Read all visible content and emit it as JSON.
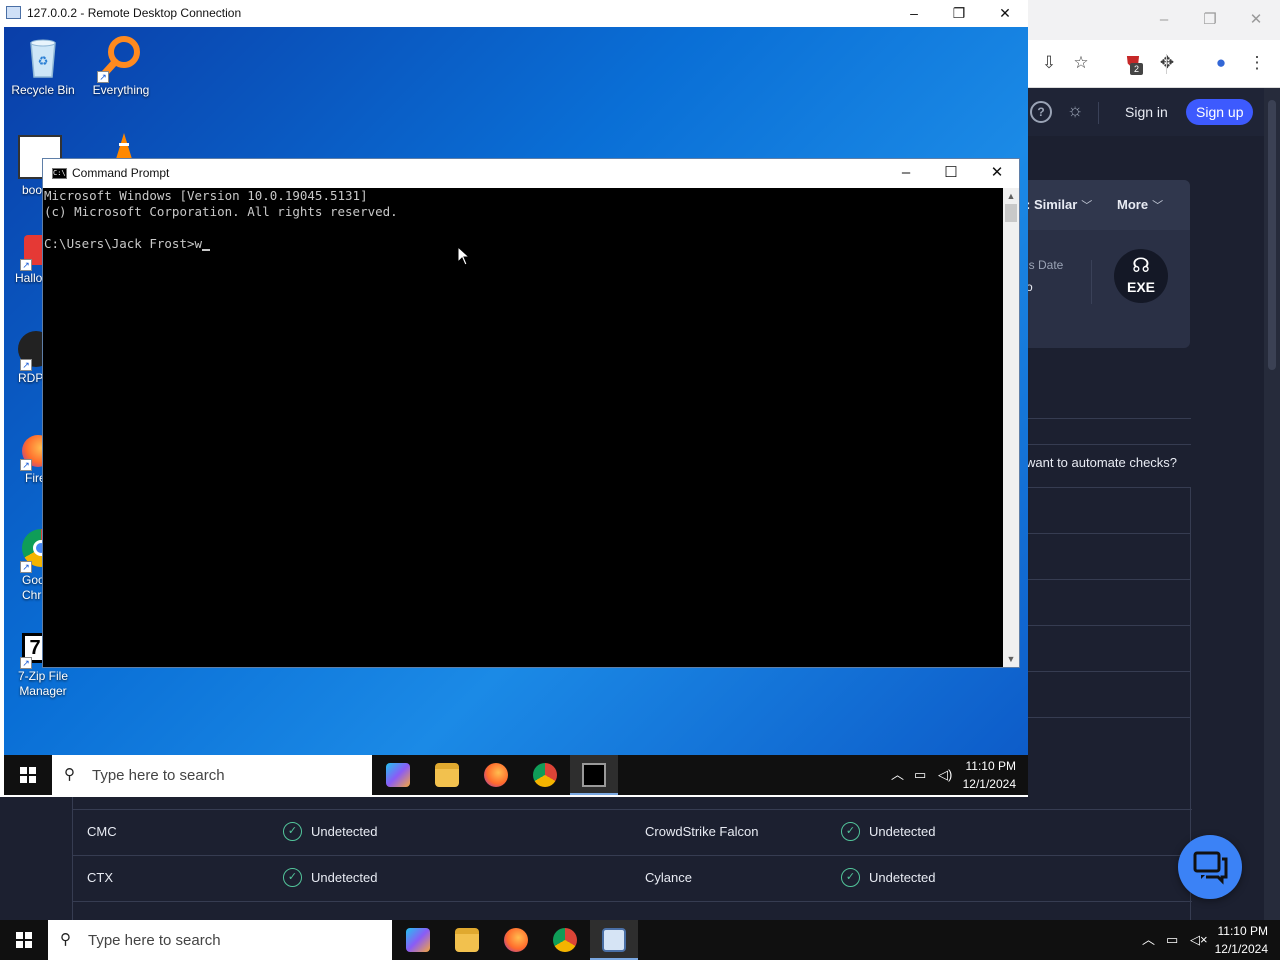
{
  "host_browser": {
    "toolbar_icons": [
      "install-app-icon",
      "bookmark-star-icon",
      "extension-shield-icon",
      "extensions-puzzle-icon",
      "profile-icon",
      "kebab-menu-icon"
    ],
    "extension_badge": "2",
    "header": {
      "sign_in": "Sign in",
      "sign_up": "Sign up"
    },
    "card": {
      "tab_similar": ": Similar",
      "tab_more": "More",
      "meta_label": "is Date",
      "meta_value": "o",
      "exe_label": "EXE"
    },
    "automate_text": "want to automate checks?"
  },
  "av_results": [
    {
      "engine_left": "CMC",
      "status_left": "Undetected",
      "engine_right": "CrowdStrike Falcon",
      "status_right": "Undetected"
    },
    {
      "engine_left": "CTX",
      "status_left": "Undetected",
      "engine_right": "Cylance",
      "status_right": "Undetected"
    }
  ],
  "rdp_window": {
    "title": "127.0.0.2 - Remote Desktop Connection"
  },
  "remote_desktop": {
    "icons": [
      {
        "label": "Recycle Bin"
      },
      {
        "label": "Everything"
      },
      {
        "label": "boo"
      },
      {
        "label": "Hallo"
      },
      {
        "label": "RDP_"
      },
      {
        "label": "Fire"
      },
      {
        "label": "Goo\nChr"
      },
      {
        "label": "7-Zip File\nManager"
      }
    ]
  },
  "cmd_window": {
    "title": "Command Prompt",
    "lines": [
      "Microsoft Windows [Version 10.0.19045.5131]",
      "(c) Microsoft Corporation. All rights reserved.",
      "",
      "C:\\Users\\Jack Frost>w"
    ]
  },
  "remote_taskbar": {
    "search_placeholder": "Type here to search",
    "time": "11:10 PM",
    "date": "12/1/2024"
  },
  "host_taskbar": {
    "search_placeholder": "Type here to search",
    "time": "11:10 PM",
    "date": "12/1/2024"
  }
}
